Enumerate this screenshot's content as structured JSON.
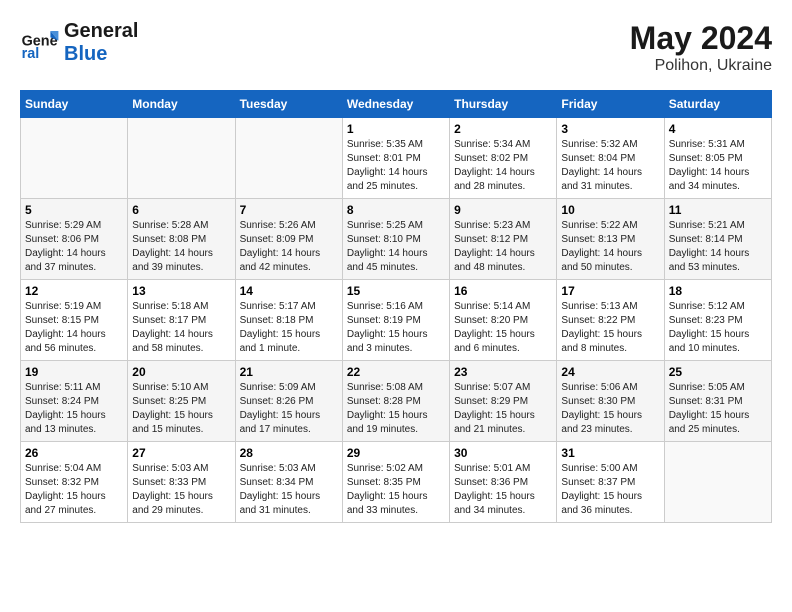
{
  "header": {
    "logo_line1": "General",
    "logo_line2": "Blue",
    "month": "May 2024",
    "location": "Polihon, Ukraine"
  },
  "weekdays": [
    "Sunday",
    "Monday",
    "Tuesday",
    "Wednesday",
    "Thursday",
    "Friday",
    "Saturday"
  ],
  "weeks": [
    [
      {
        "day": "",
        "info": ""
      },
      {
        "day": "",
        "info": ""
      },
      {
        "day": "",
        "info": ""
      },
      {
        "day": "1",
        "info": "Sunrise: 5:35 AM\nSunset: 8:01 PM\nDaylight: 14 hours\nand 25 minutes."
      },
      {
        "day": "2",
        "info": "Sunrise: 5:34 AM\nSunset: 8:02 PM\nDaylight: 14 hours\nand 28 minutes."
      },
      {
        "day": "3",
        "info": "Sunrise: 5:32 AM\nSunset: 8:04 PM\nDaylight: 14 hours\nand 31 minutes."
      },
      {
        "day": "4",
        "info": "Sunrise: 5:31 AM\nSunset: 8:05 PM\nDaylight: 14 hours\nand 34 minutes."
      }
    ],
    [
      {
        "day": "5",
        "info": "Sunrise: 5:29 AM\nSunset: 8:06 PM\nDaylight: 14 hours\nand 37 minutes."
      },
      {
        "day": "6",
        "info": "Sunrise: 5:28 AM\nSunset: 8:08 PM\nDaylight: 14 hours\nand 39 minutes."
      },
      {
        "day": "7",
        "info": "Sunrise: 5:26 AM\nSunset: 8:09 PM\nDaylight: 14 hours\nand 42 minutes."
      },
      {
        "day": "8",
        "info": "Sunrise: 5:25 AM\nSunset: 8:10 PM\nDaylight: 14 hours\nand 45 minutes."
      },
      {
        "day": "9",
        "info": "Sunrise: 5:23 AM\nSunset: 8:12 PM\nDaylight: 14 hours\nand 48 minutes."
      },
      {
        "day": "10",
        "info": "Sunrise: 5:22 AM\nSunset: 8:13 PM\nDaylight: 14 hours\nand 50 minutes."
      },
      {
        "day": "11",
        "info": "Sunrise: 5:21 AM\nSunset: 8:14 PM\nDaylight: 14 hours\nand 53 minutes."
      }
    ],
    [
      {
        "day": "12",
        "info": "Sunrise: 5:19 AM\nSunset: 8:15 PM\nDaylight: 14 hours\nand 56 minutes."
      },
      {
        "day": "13",
        "info": "Sunrise: 5:18 AM\nSunset: 8:17 PM\nDaylight: 14 hours\nand 58 minutes."
      },
      {
        "day": "14",
        "info": "Sunrise: 5:17 AM\nSunset: 8:18 PM\nDaylight: 15 hours\nand 1 minute."
      },
      {
        "day": "15",
        "info": "Sunrise: 5:16 AM\nSunset: 8:19 PM\nDaylight: 15 hours\nand 3 minutes."
      },
      {
        "day": "16",
        "info": "Sunrise: 5:14 AM\nSunset: 8:20 PM\nDaylight: 15 hours\nand 6 minutes."
      },
      {
        "day": "17",
        "info": "Sunrise: 5:13 AM\nSunset: 8:22 PM\nDaylight: 15 hours\nand 8 minutes."
      },
      {
        "day": "18",
        "info": "Sunrise: 5:12 AM\nSunset: 8:23 PM\nDaylight: 15 hours\nand 10 minutes."
      }
    ],
    [
      {
        "day": "19",
        "info": "Sunrise: 5:11 AM\nSunset: 8:24 PM\nDaylight: 15 hours\nand 13 minutes."
      },
      {
        "day": "20",
        "info": "Sunrise: 5:10 AM\nSunset: 8:25 PM\nDaylight: 15 hours\nand 15 minutes."
      },
      {
        "day": "21",
        "info": "Sunrise: 5:09 AM\nSunset: 8:26 PM\nDaylight: 15 hours\nand 17 minutes."
      },
      {
        "day": "22",
        "info": "Sunrise: 5:08 AM\nSunset: 8:28 PM\nDaylight: 15 hours\nand 19 minutes."
      },
      {
        "day": "23",
        "info": "Sunrise: 5:07 AM\nSunset: 8:29 PM\nDaylight: 15 hours\nand 21 minutes."
      },
      {
        "day": "24",
        "info": "Sunrise: 5:06 AM\nSunset: 8:30 PM\nDaylight: 15 hours\nand 23 minutes."
      },
      {
        "day": "25",
        "info": "Sunrise: 5:05 AM\nSunset: 8:31 PM\nDaylight: 15 hours\nand 25 minutes."
      }
    ],
    [
      {
        "day": "26",
        "info": "Sunrise: 5:04 AM\nSunset: 8:32 PM\nDaylight: 15 hours\nand 27 minutes."
      },
      {
        "day": "27",
        "info": "Sunrise: 5:03 AM\nSunset: 8:33 PM\nDaylight: 15 hours\nand 29 minutes."
      },
      {
        "day": "28",
        "info": "Sunrise: 5:03 AM\nSunset: 8:34 PM\nDaylight: 15 hours\nand 31 minutes."
      },
      {
        "day": "29",
        "info": "Sunrise: 5:02 AM\nSunset: 8:35 PM\nDaylight: 15 hours\nand 33 minutes."
      },
      {
        "day": "30",
        "info": "Sunrise: 5:01 AM\nSunset: 8:36 PM\nDaylight: 15 hours\nand 34 minutes."
      },
      {
        "day": "31",
        "info": "Sunrise: 5:00 AM\nSunset: 8:37 PM\nDaylight: 15 hours\nand 36 minutes."
      },
      {
        "day": "",
        "info": ""
      }
    ]
  ]
}
